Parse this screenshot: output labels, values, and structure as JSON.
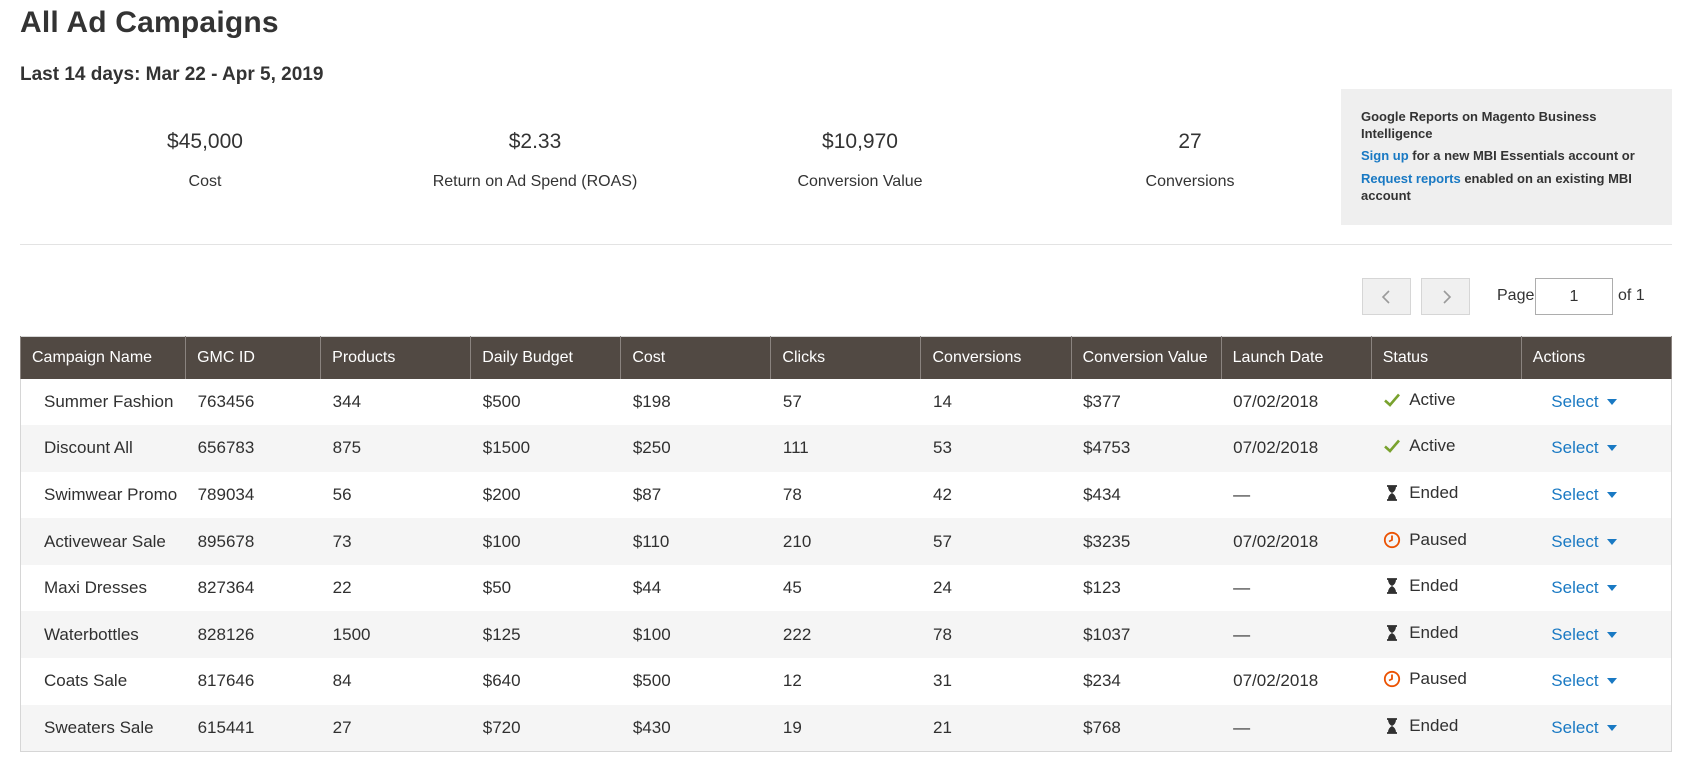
{
  "page_title": "All Ad Campaigns",
  "period": "Last 14 days: Mar 22 - Apr 5, 2019",
  "stats": [
    {
      "value": "$45,000",
      "label": "Cost"
    },
    {
      "value": "$2.33",
      "label": "Return on Ad Spend (ROAS)"
    },
    {
      "value": "$10,970",
      "label": "Conversion Value"
    },
    {
      "value": "27",
      "label": "Conversions"
    }
  ],
  "mbi": {
    "title": "Google Reports on Magento Business Intelligence",
    "signup_link": "Sign up",
    "signup_text": " for a new MBI Essentials account or",
    "request_link": "Request reports",
    "request_text": " enabled on an existing MBI account"
  },
  "pager": {
    "label": "Page",
    "current": "1",
    "of": "of 1"
  },
  "columns": [
    "Campaign Name",
    "GMC ID",
    "Products",
    "Daily Budget",
    "Cost",
    "Clicks",
    "Conversions",
    "Conversion Value",
    "Launch Date",
    "Status",
    "Actions"
  ],
  "rows": [
    {
      "name": "Summer Fashion",
      "gmc": "763456",
      "products": "344",
      "budget": "$500",
      "cost": "$198",
      "clicks": "57",
      "conversions": "14",
      "value": "$377",
      "date": "07/02/2018",
      "status": "Active",
      "status_icon": "check-icon",
      "action": "Select"
    },
    {
      "name": "Discount All",
      "gmc": "656783",
      "products": "875",
      "budget": "$1500",
      "cost": "$250",
      "clicks": "111",
      "conversions": "53",
      "value": "$4753",
      "date": "07/02/2018",
      "status": "Active",
      "status_icon": "check-icon",
      "action": "Select"
    },
    {
      "name": "Swimwear Promo",
      "gmc": "789034",
      "products": "56",
      "budget": "$200",
      "cost": "$87",
      "clicks": "78",
      "conversions": "42",
      "value": "$434",
      "date": "—",
      "status": "Ended",
      "status_icon": "hourglass-icon",
      "action": "Select"
    },
    {
      "name": "Activewear Sale",
      "gmc": "895678",
      "products": "73",
      "budget": "$100",
      "cost": "$110",
      "clicks": "210",
      "conversions": "57",
      "value": "$3235",
      "date": "07/02/2018",
      "status": "Paused",
      "status_icon": "clock-icon",
      "action": "Select"
    },
    {
      "name": "Maxi Dresses",
      "gmc": "827364",
      "products": "22",
      "budget": "$50",
      "cost": "$44",
      "clicks": "45",
      "conversions": "24",
      "value": "$123",
      "date": "—",
      "status": "Ended",
      "status_icon": "hourglass-icon",
      "action": "Select"
    },
    {
      "name": "Waterbottles",
      "gmc": "828126",
      "products": "1500",
      "budget": "$125",
      "cost": "$100",
      "clicks": "222",
      "conversions": "78",
      "value": "$1037",
      "date": "—",
      "status": "Ended",
      "status_icon": "hourglass-icon",
      "action": "Select"
    },
    {
      "name": "Coats Sale",
      "gmc": "817646",
      "products": "84",
      "budget": "$640",
      "cost": "$500",
      "clicks": "12",
      "conversions": "31",
      "value": "$234",
      "date": "07/02/2018",
      "status": "Paused",
      "status_icon": "clock-icon",
      "action": "Select"
    },
    {
      "name": "Sweaters Sale",
      "gmc": "615441",
      "products": "27",
      "budget": "$720",
      "cost": "$430",
      "clicks": "19",
      "conversions": "21",
      "value": "$768",
      "date": "—",
      "status": "Ended",
      "status_icon": "hourglass-icon",
      "action": "Select"
    }
  ],
  "colors": {
    "header_bg": "#514943",
    "link": "#1979c3",
    "active": "#79a22e",
    "paused": "#eb5202",
    "ended": "#303030"
  }
}
